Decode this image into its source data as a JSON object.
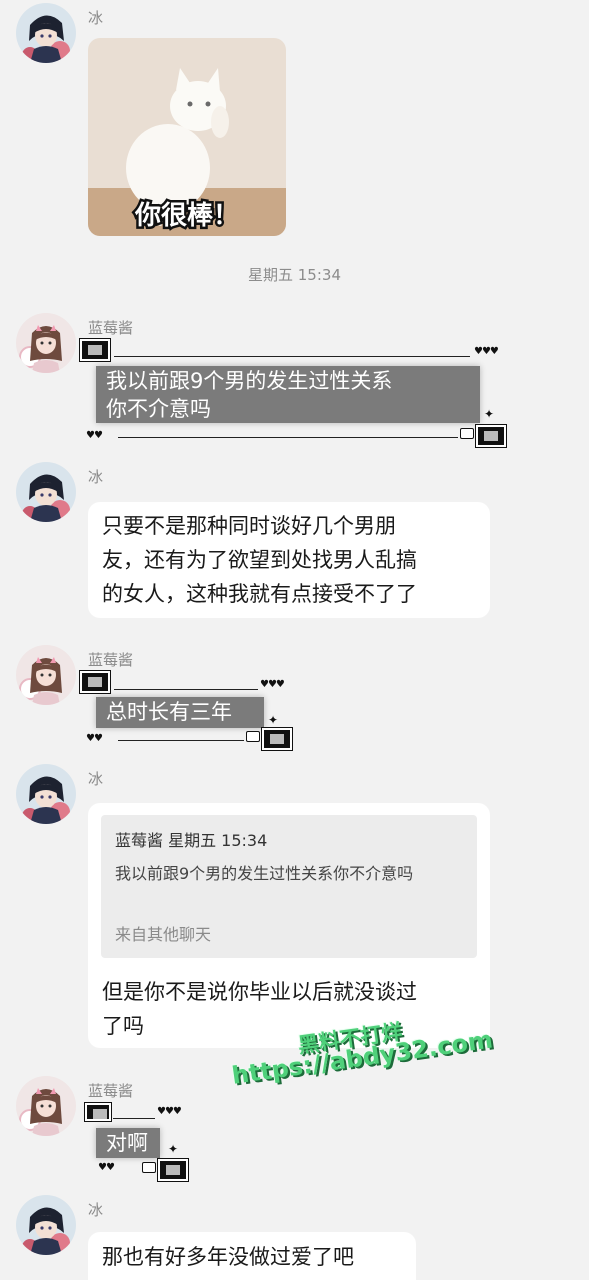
{
  "contacts": {
    "bing": {
      "name": "冰"
    },
    "lanmeijiang": {
      "name": "蓝莓酱"
    }
  },
  "sticker": {
    "caption": "你很棒！"
  },
  "timestamp": "星期五 15:34",
  "messages": {
    "m1": [
      "我以前跟9个男的发生过性关系",
      "你不介意吗"
    ],
    "m2": [
      "只要不是那种同时谈好几个男朋",
      "友，还有为了欲望到处找男人乱搞",
      "的女人，这种我就有点接受不了了"
    ],
    "m3": "总时长有三年",
    "m4": {
      "quote_sender": "蓝莓酱  星期五 15:34",
      "quote_text": "我以前跟9个男的发生过性关系你不介意吗",
      "quote_source": "来自其他聊天",
      "lines": [
        "但是你不是说你毕业以后就没谈过",
        "了吗"
      ]
    },
    "m5": "对啊",
    "m6": "那也有好多年没做过爱了吧"
  },
  "watermark": {
    "line1": "黑料不打烊",
    "line2": "https://abdy32.com"
  },
  "colors": {
    "background": "#f2f2f2",
    "bubble": "#ffffff",
    "deco_bubble": "#7b7b7b",
    "watermark": "#4fd07a"
  },
  "icons": {
    "bing_avatar": "anime-boy-avatar",
    "lanmeijiang_avatar": "cosplay-girl-avatar"
  }
}
